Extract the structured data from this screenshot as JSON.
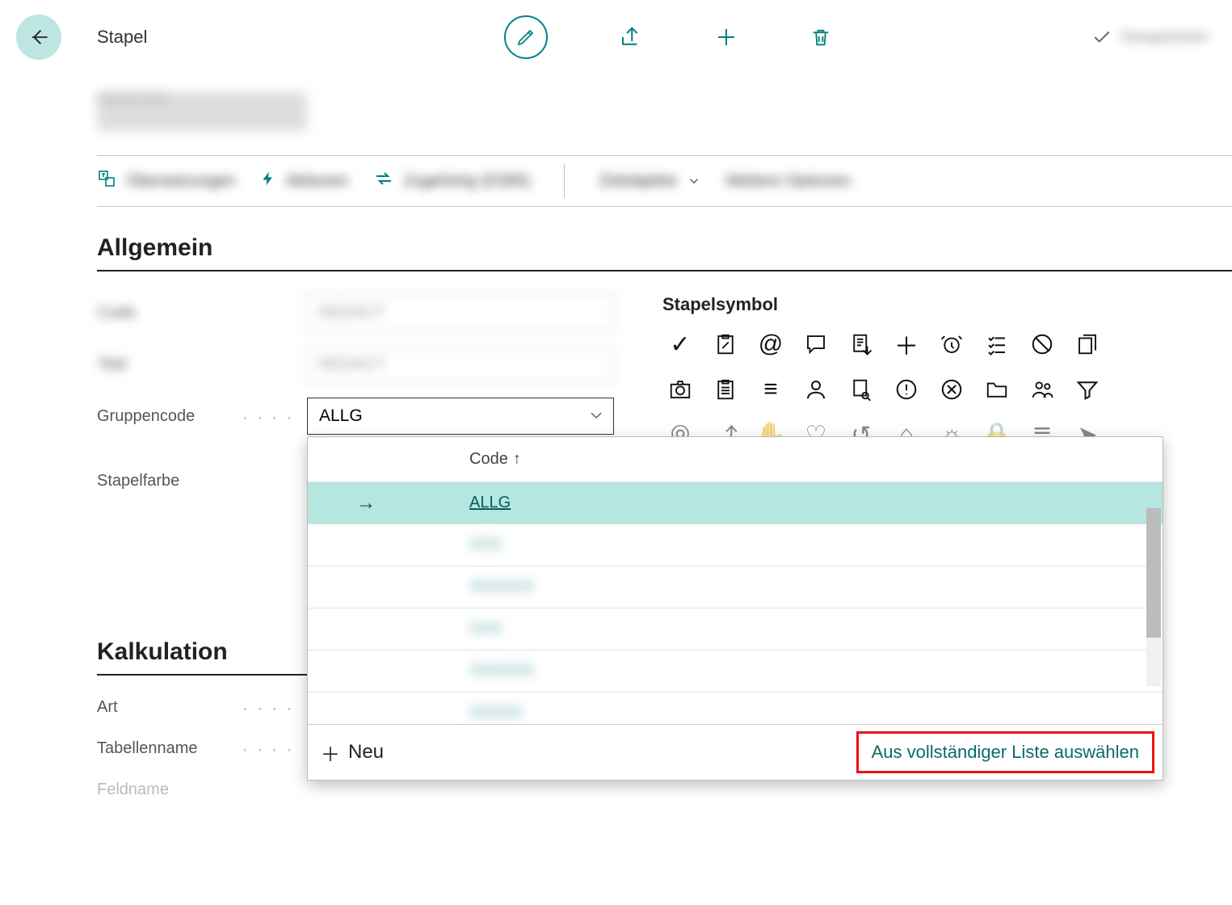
{
  "header": {
    "title": "Stapel",
    "saved_label": "Gespeichert"
  },
  "record_title_blur": "REDACTED",
  "actions": {
    "a1": "Übersetzungen",
    "a2": "Aktionen",
    "a3": "Zugehörig (D365)",
    "a4": "Zielobjekte",
    "a5": "Weitere Optionen"
  },
  "section_general": "Allgemein",
  "labels": {
    "l1": "Code",
    "l2": "Titel",
    "group_code": "Gruppencode",
    "stapel_color": "Stapelfarbe",
    "section_calc": "Kalkulation",
    "art": "Art",
    "tablename": "Tabellenname",
    "feldname": "Feldname"
  },
  "values": {
    "v1": "REDACT",
    "v2": "REDACT",
    "group_code": "ALLG"
  },
  "palette_title": "Stapelsymbol",
  "popup": {
    "col_header": "Code",
    "rows": [
      {
        "code": "ALLG",
        "selected": true
      },
      {
        "code": "XXX",
        "selected": false
      },
      {
        "code": "XXXXXX",
        "selected": false
      },
      {
        "code": "XXX",
        "selected": false
      },
      {
        "code": "XXXXXX",
        "selected": false
      },
      {
        "code": "XXXXX",
        "selected": false
      }
    ],
    "new_label": "Neu",
    "full_list_label": "Aus vollständiger Liste auswählen"
  },
  "icons": {
    "back": "arrow-left",
    "edit": "pencil",
    "share": "share",
    "new": "plus",
    "delete": "trash",
    "check": "check"
  }
}
